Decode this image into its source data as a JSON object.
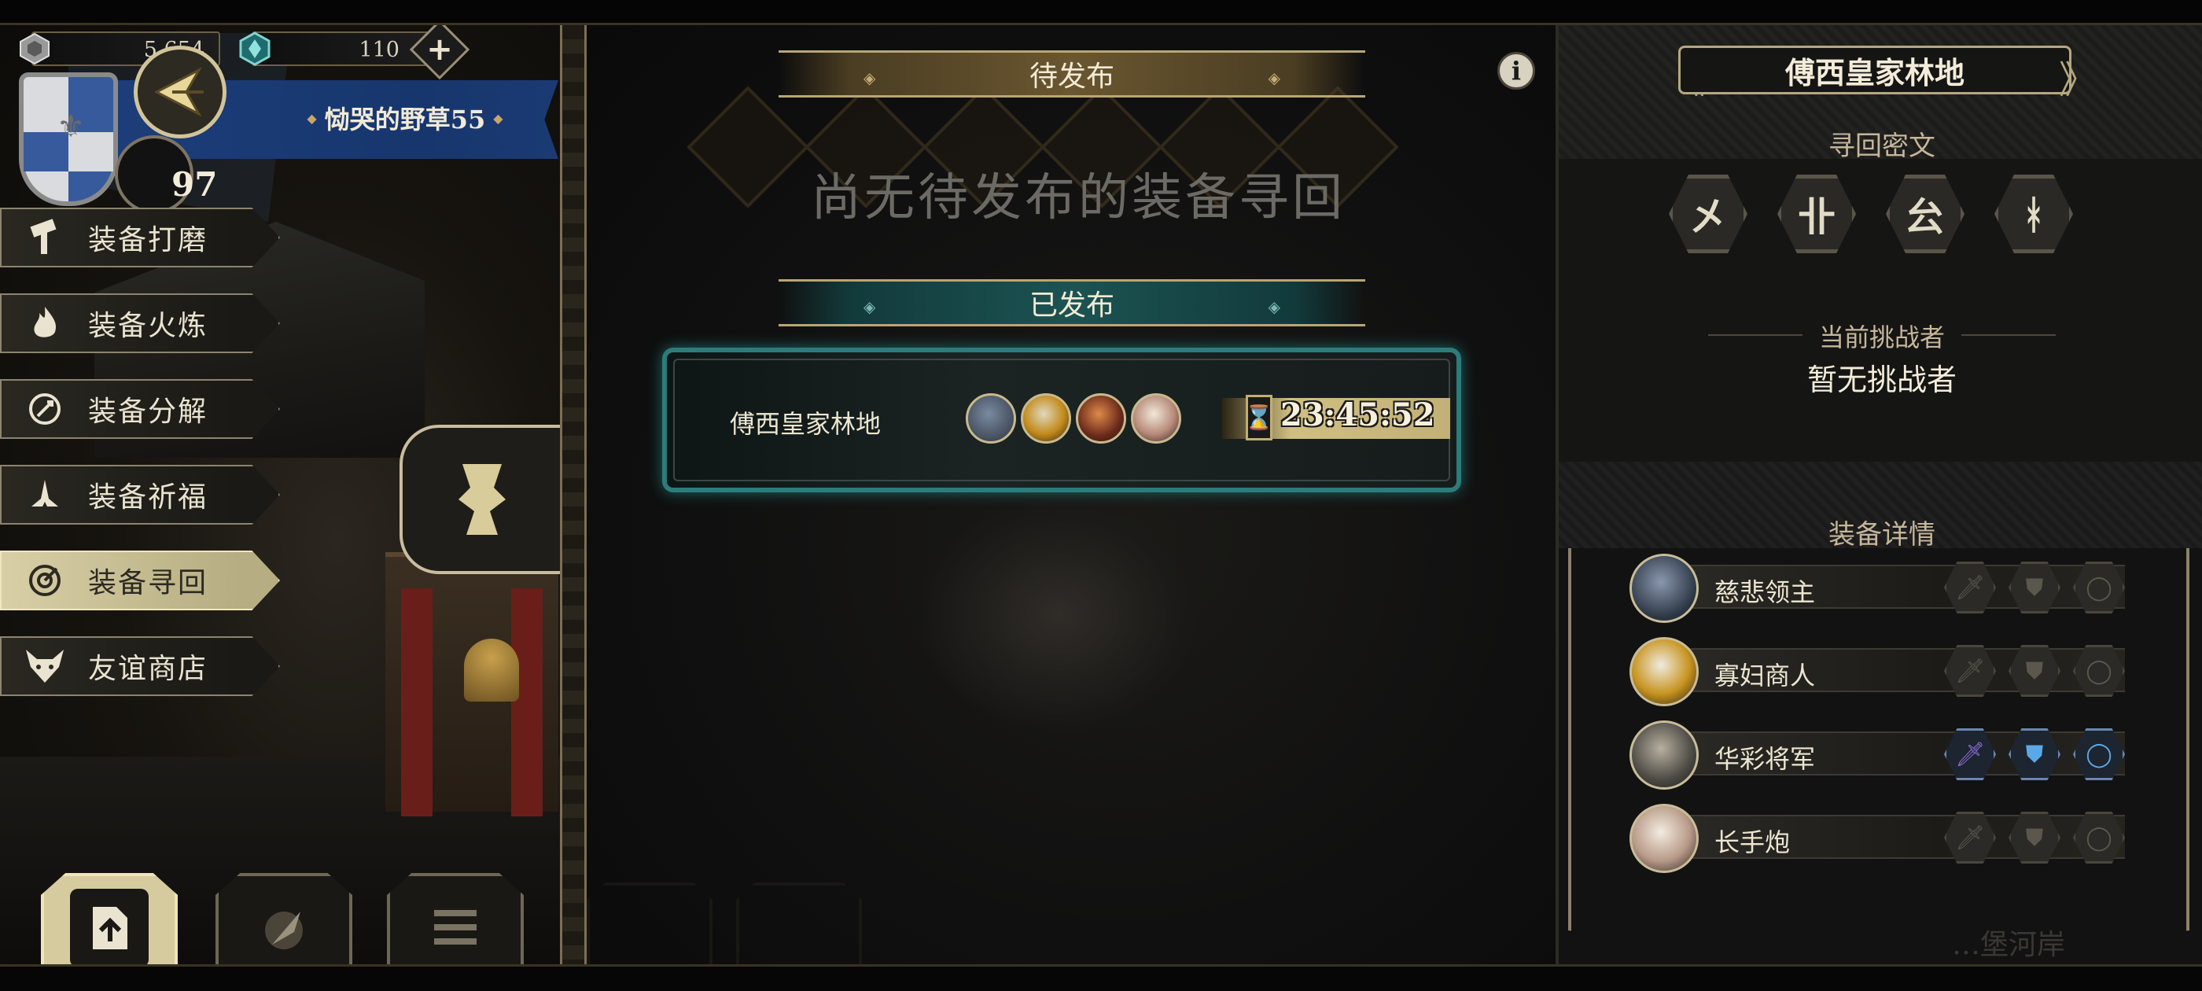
{
  "resources": {
    "silver": {
      "icon": "silver-coin-icon",
      "value": "5,654"
    },
    "gems": {
      "icon": "gem-icon",
      "value": "110"
    },
    "add_label": "+"
  },
  "player": {
    "name": "恸哭的野草55",
    "level": "97",
    "shield_icon": "fleur-de-lis-shield-icon",
    "rank_icon": "arrow-rank-icon"
  },
  "menu": [
    {
      "label": "装备打磨",
      "icon": "hammer-icon",
      "active": false
    },
    {
      "label": "装备火炼",
      "icon": "flame-icon",
      "active": false
    },
    {
      "label": "装备分解",
      "icon": "decompose-icon",
      "active": false
    },
    {
      "label": "装备祈福",
      "icon": "prayer-hands-icon",
      "active": false
    },
    {
      "label": "装备寻回",
      "icon": "target-icon",
      "active": true
    },
    {
      "label": "友谊商店",
      "icon": "fox-icon",
      "active": false
    }
  ],
  "bottom_tabs": [
    {
      "icon": "upload-icon",
      "active": true
    },
    {
      "icon": "quill-icon",
      "active": false
    },
    {
      "icon": "list-icon",
      "active": false
    }
  ],
  "center": {
    "pending_title": "待发布",
    "pending_empty": "尚无待发布的装备寻回",
    "published_title": "已发布",
    "info_label": "i",
    "published_items": [
      {
        "name": "傅西皇家林地",
        "timer": "23:45:52",
        "avatars": [
          "wolf-avatar-icon",
          "bird-avatar-icon",
          "dwarf-avatar-icon",
          "goat-avatar-icon"
        ]
      }
    ]
  },
  "detail": {
    "title": "傅西皇家林地",
    "cipher_title": "寻回密文",
    "runes": [
      "㐅",
      "卝",
      "㕕",
      "ᚼ"
    ],
    "challenger_label": "当前挑战者",
    "challenger_value": "暂无挑战者",
    "equipment_title": "装备详情",
    "equipment": [
      {
        "name": "慈悲领主",
        "slots": {
          "weapon": false,
          "armor": false,
          "ring": false
        }
      },
      {
        "name": "寡妇商人",
        "slots": {
          "weapon": false,
          "armor": false,
          "ring": false
        }
      },
      {
        "name": "华彩将军",
        "slots": {
          "weapon": true,
          "armor": true,
          "ring": true
        }
      },
      {
        "name": "长手炮",
        "slots": {
          "weapon": false,
          "armor": false,
          "ring": false
        }
      }
    ],
    "faint_footer": "…堡河岸"
  },
  "colors": {
    "accent_gold": "#c7a66b",
    "accent_teal": "#2c7c7b",
    "banner_blue": "#1d3e7a",
    "weapon_purple": "#8f6fd8",
    "armor_blue": "#5aa9e6"
  }
}
